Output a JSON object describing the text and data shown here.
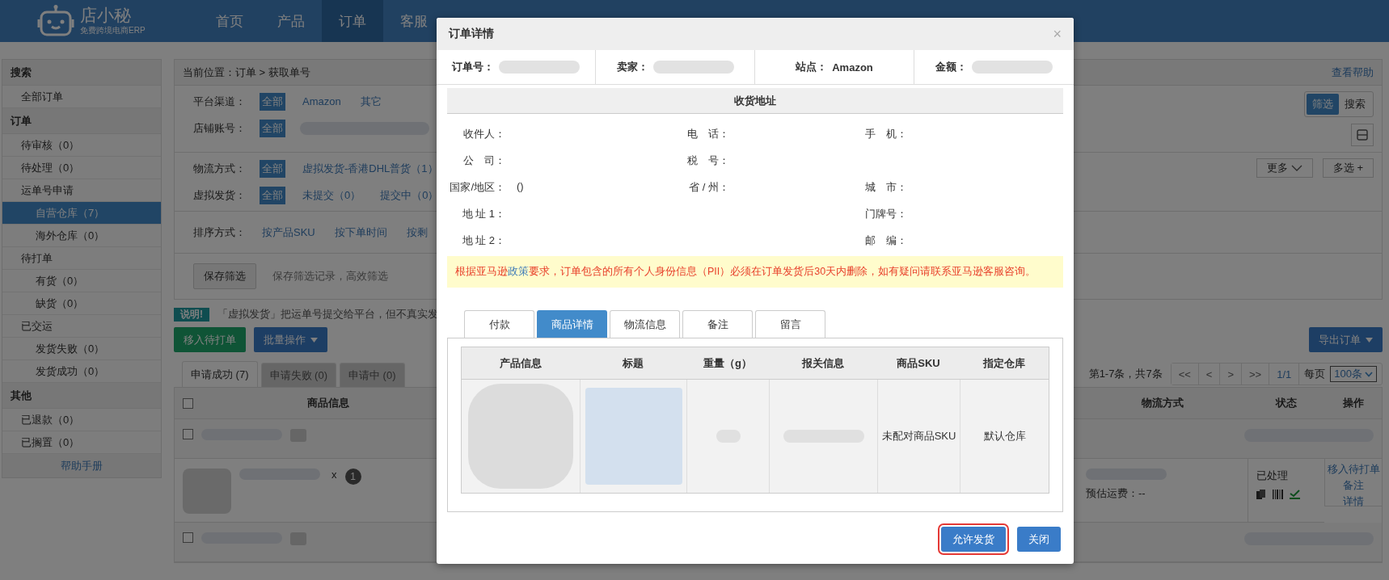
{
  "header": {
    "logo_name": "店小秘",
    "logo_tagline": "免费跨境电商ERP",
    "nav": [
      {
        "label": "首页",
        "selected": false
      },
      {
        "label": "产品",
        "selected": false
      },
      {
        "label": "订单",
        "selected": true
      },
      {
        "label": "客服",
        "selected": false
      }
    ]
  },
  "sidebar": {
    "sections": [
      {
        "title": "搜索",
        "items": [
          {
            "label": "全部订单",
            "selected": false
          }
        ]
      },
      {
        "title": "订单",
        "items": [
          {
            "label": "待审核（0）",
            "selected": false
          },
          {
            "label": "待处理（0）",
            "selected": false
          },
          {
            "label": "运单号申请",
            "selected": false,
            "children": [
              {
                "label": "自营仓库（7）",
                "selected": true
              },
              {
                "label": "海外仓库（0）",
                "selected": false
              }
            ]
          },
          {
            "label": "待打单",
            "selected": false,
            "children": [
              {
                "label": "有货（0）",
                "selected": false
              },
              {
                "label": "缺货（0）",
                "selected": false
              }
            ]
          },
          {
            "label": "已交运",
            "selected": false,
            "children": [
              {
                "label": "发货失败（0）",
                "selected": false
              },
              {
                "label": "发货成功（0）",
                "selected": false
              }
            ]
          }
        ]
      },
      {
        "title": "其他",
        "items": [
          {
            "label": "已退款（0）",
            "selected": false
          },
          {
            "label": "已搁置（0）",
            "selected": false
          }
        ]
      }
    ],
    "help_link": "帮助手册"
  },
  "breadcrumb": "当前位置：订单 > 获取单号",
  "help_link": "查看帮助",
  "filters": {
    "sections": [
      {
        "rows": [
          {
            "label": "平台渠道：",
            "options": [
              {
                "kind": "text",
                "label": "全部",
                "selected": true
              },
              {
                "kind": "text",
                "label": "Amazon",
                "selected": false
              },
              {
                "kind": "text",
                "label": "其它",
                "selected": false
              }
            ]
          },
          {
            "label": "店铺账号：",
            "options": [
              {
                "kind": "text",
                "label": "全部",
                "selected": true
              },
              {
                "kind": "redacted"
              }
            ]
          }
        ]
      },
      {
        "rows": [
          {
            "label": "物流方式：",
            "options": [
              {
                "kind": "text",
                "label": "全部",
                "selected": true
              },
              {
                "kind": "text",
                "label": "虚拟发货-香港DHL普货（1）",
                "selected": false
              }
            ]
          },
          {
            "label": "虚拟发货：",
            "options": [
              {
                "kind": "text",
                "label": "全部",
                "selected": true
              },
              {
                "kind": "text",
                "label": "未提交（0）",
                "selected": false
              },
              {
                "kind": "text",
                "label": "提交中（0）",
                "selected": false
              }
            ]
          }
        ]
      },
      {
        "rows": [
          {
            "label": "排序方式：",
            "options": [
              {
                "kind": "text",
                "label": "按产品SKU",
                "selected": false
              },
              {
                "kind": "text",
                "label": "按下单时间",
                "selected": false
              },
              {
                "kind": "text",
                "label": "按剩",
                "selected": false
              }
            ]
          }
        ]
      }
    ],
    "view_toggle": [
      {
        "label": "筛选",
        "selected": true
      },
      {
        "label": "搜索",
        "selected": false
      }
    ],
    "more_button": "更多",
    "multi_button": "多选 +",
    "save_button": "保存筛选",
    "save_hint": "保存筛选记录，高效筛选"
  },
  "notice": {
    "badge": "说明!",
    "text": "「虚拟发货」把运单号提交给平台，但不真实发"
  },
  "actions": {
    "move_button": "移入待打单",
    "batch_button": "批量操作",
    "export_button": "导出订单"
  },
  "list_tabs": [
    {
      "label": "申请成功 (7)",
      "selected": true
    },
    {
      "label": "申请失败 (0)",
      "selected": false
    },
    {
      "label": "申请中 (0)",
      "selected": false
    }
  ],
  "pagination": {
    "summary": "第1-7条，共7条",
    "buttons": [
      "<<",
      "<",
      ">",
      ">>"
    ],
    "page": "1/1",
    "per_page_label": "每页",
    "per_page": "100条"
  },
  "table": {
    "select_all_checked": false,
    "columns": [
      "商品信息",
      "",
      "物流方式",
      "状态",
      "操作"
    ],
    "rows": [
      {
        "kind": "order",
        "checked": false
      },
      {
        "kind": "item",
        "quantity_prefix": "x",
        "quantity": "1",
        "shipping_fee": "预估运费：--",
        "status": "已处理",
        "actions": [
          "移入待打单",
          "备注",
          "详情"
        ]
      },
      {
        "kind": "order",
        "checked": false
      }
    ]
  },
  "modal": {
    "title": "订单详情",
    "close": "×",
    "info": [
      {
        "label": "订单号：",
        "kind": "redacted"
      },
      {
        "label": "卖家：",
        "kind": "redacted"
      },
      {
        "label": "站点：",
        "kind": "text",
        "value": "Amazon"
      },
      {
        "label": "金额：",
        "kind": "redacted"
      }
    ],
    "address_title": "收货地址",
    "address_rows": [
      [
        {
          "label": "收件人："
        },
        {
          "label": "电　话："
        },
        {
          "label": "手　机："
        }
      ],
      [
        {
          "label": "公　司："
        },
        {
          "label": "税　号："
        },
        null
      ],
      [
        {
          "label": "国家/地区：",
          "value": "()"
        },
        {
          "label": "省 / 州："
        },
        {
          "label": "城　市："
        }
      ],
      [
        {
          "label": "地 址 1："
        },
        null,
        {
          "label": "门牌号："
        }
      ],
      [
        {
          "label": "地 址 2："
        },
        null,
        {
          "label": "邮　编："
        }
      ]
    ],
    "notice": {
      "before": "根据亚马逊",
      "link": "政策",
      "after": "要求，订单包含的所有个人身份信息（PII）必须在订单发货后30天内删除，如有疑问请联系亚马逊客服咨询。"
    },
    "tabs": [
      {
        "label": "付款",
        "selected": false
      },
      {
        "label": "商品详情",
        "selected": true
      },
      {
        "label": "物流信息",
        "selected": false
      },
      {
        "label": "备注",
        "selected": false
      },
      {
        "label": "留言",
        "selected": false
      }
    ],
    "product_table": {
      "columns": [
        "产品信息",
        "标题",
        "重量（g）",
        "报关信息",
        "商品SKU",
        "指定仓库"
      ],
      "rows": [
        {
          "cells": [
            {
              "kind": "photo"
            },
            {
              "kind": "redacted"
            },
            {
              "kind": "redacted"
            },
            {
              "kind": "redacted"
            },
            {
              "kind": "text",
              "text": "未配对商品SKU"
            },
            {
              "kind": "text",
              "text": "默认仓库"
            }
          ]
        }
      ]
    },
    "buttons": [
      {
        "label": "允许发货",
        "highlighted": true
      },
      {
        "label": "关闭",
        "highlighted": false
      }
    ]
  }
}
